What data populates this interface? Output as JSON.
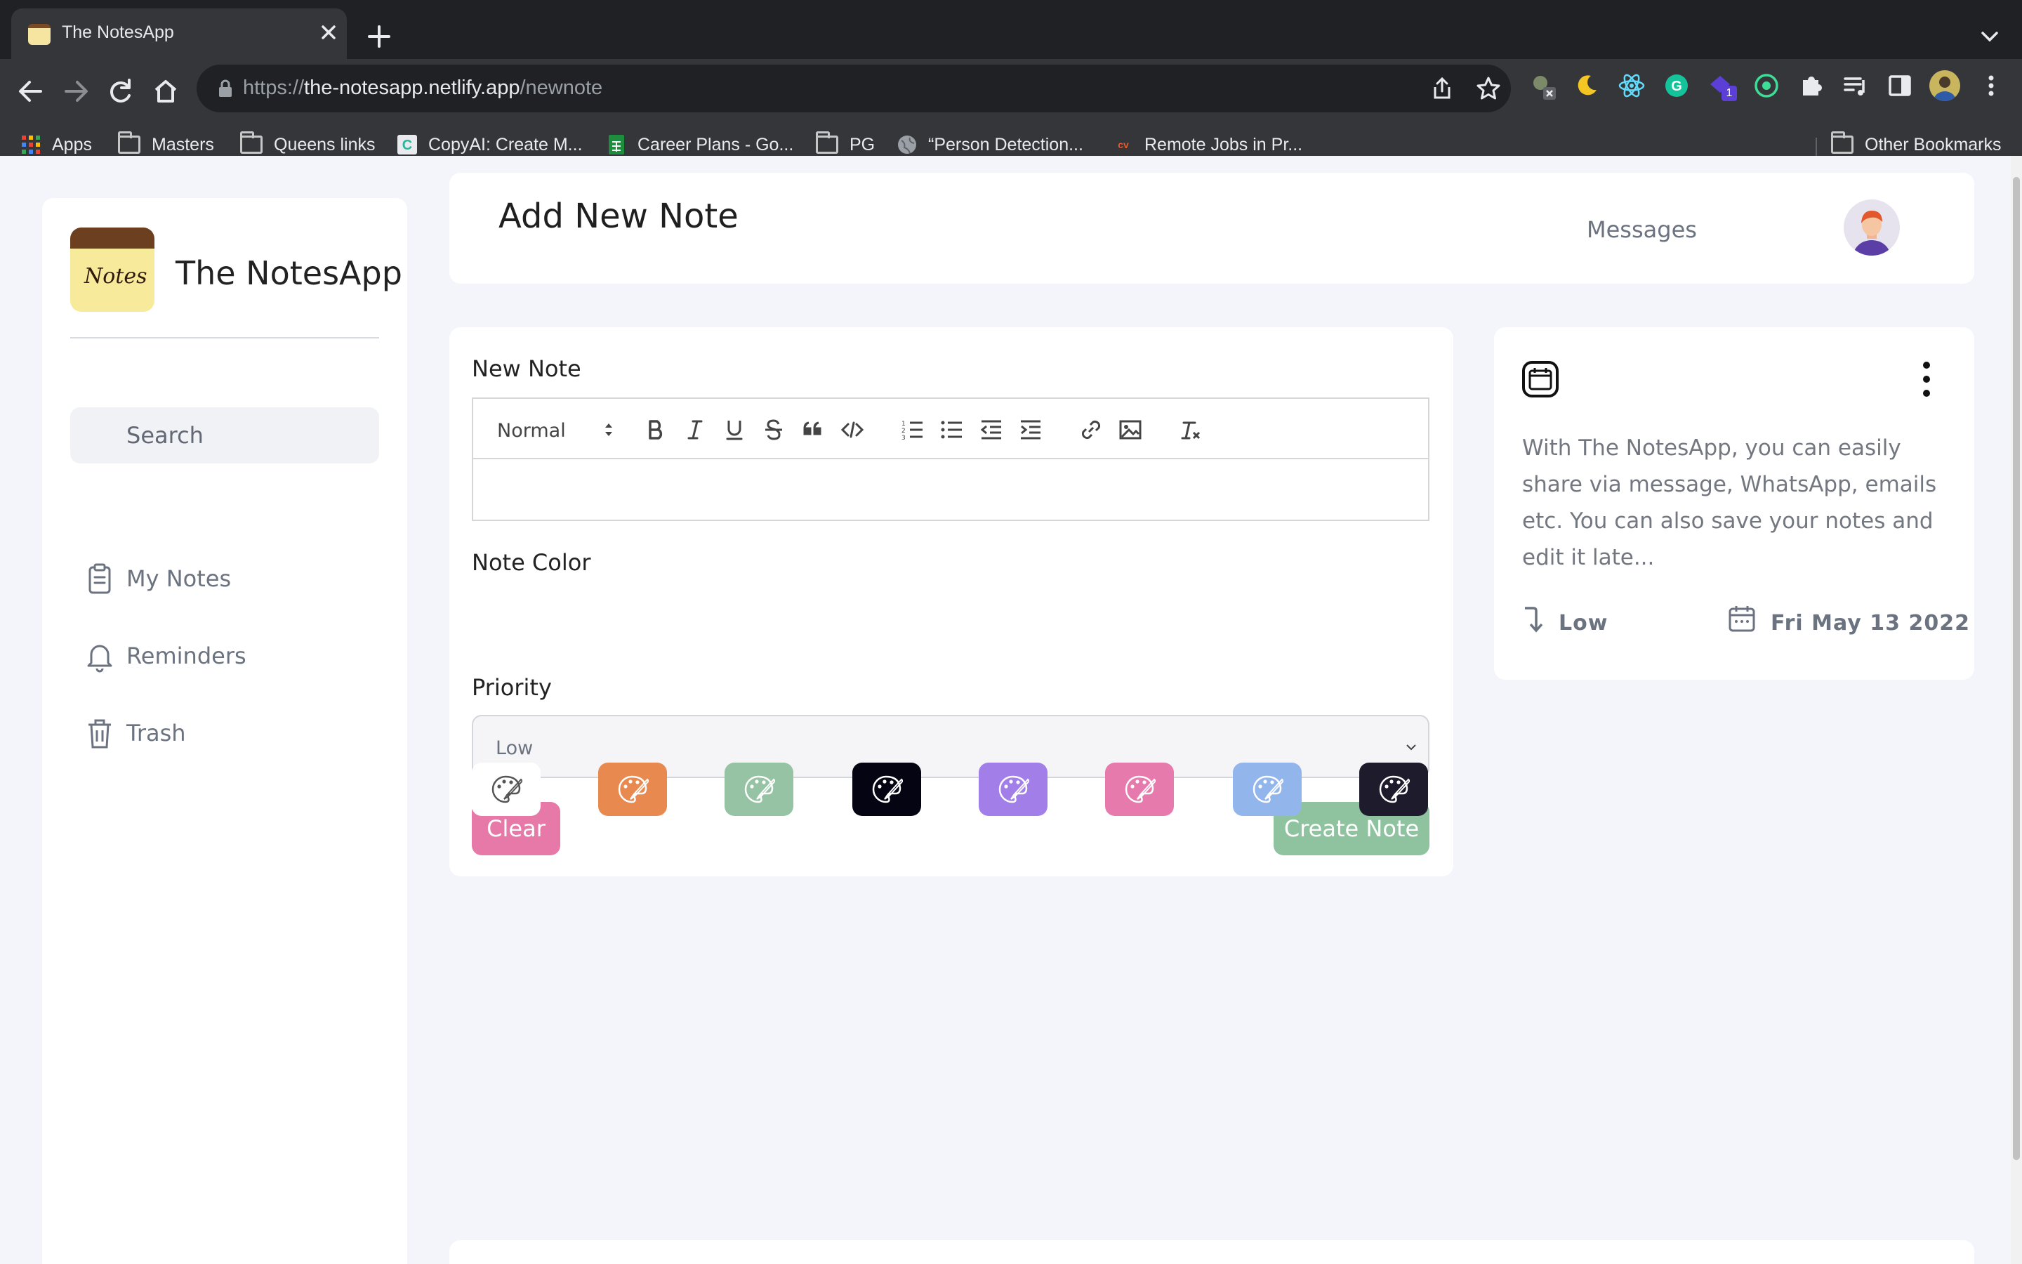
{
  "browser": {
    "tab_title": "The NotesApp",
    "url_scheme": "https://",
    "url_host": "the-notesapp.netlify.app",
    "url_path": "/newnote",
    "bookmarks": [
      {
        "label": "Apps",
        "icon": "apps-grid-icon"
      },
      {
        "label": "Masters",
        "icon": "folder-icon"
      },
      {
        "label": "Queens links",
        "icon": "folder-icon"
      },
      {
        "label": "CopyAI: Create M...",
        "icon": "copyai-icon"
      },
      {
        "label": "Career Plans - Go...",
        "icon": "sheets-icon"
      },
      {
        "label": "PG",
        "icon": "folder-icon"
      },
      {
        "label": "“Person Detection...",
        "icon": "globe-icon"
      },
      {
        "label": "Remote Jobs in Pr...",
        "icon": "cv-icon"
      }
    ],
    "other_bookmarks": "Other Bookmarks",
    "extension_badge": "1"
  },
  "sidebar": {
    "app_name": "The NotesApp",
    "logo_text": "Notes",
    "search_placeholder": "Search",
    "nav": [
      {
        "label": "My Notes",
        "icon": "clipboard-icon"
      },
      {
        "label": "Reminders",
        "icon": "bell-icon"
      },
      {
        "label": "Trash",
        "icon": "trash-icon"
      }
    ]
  },
  "header": {
    "title": "Add New Note",
    "messages": "Messages"
  },
  "form": {
    "new_note_label": "New Note",
    "editor_format": "Normal",
    "editor_value": "",
    "toolbar_tools": [
      "bold-icon",
      "italic-icon",
      "underline-icon",
      "strikethrough-icon",
      "blockquote-icon",
      "code-icon",
      "ordered-list-icon",
      "bullet-list-icon",
      "outdent-icon",
      "indent-icon",
      "link-icon",
      "image-icon",
      "clear-format-icon"
    ],
    "note_color_label": "Note Color",
    "colors": [
      "#ffffff",
      "#e8894f",
      "#96c3a3",
      "#040412",
      "#a17ee8",
      "#e67aac",
      "#92b5ec",
      "#1e1b2c"
    ],
    "priority_label": "Priority",
    "priority_value": "Low",
    "clear_label": "Clear",
    "create_label": "Create Note"
  },
  "preview": {
    "text": "With The NotesApp, you can easily share via message, WhatsApp, emails etc. You can also save your notes and edit it late...",
    "priority": "Low",
    "date": "Fri May 13 2022"
  },
  "colors": {
    "page_bg": "#f4f5fa",
    "clear_button": "#e779a9",
    "create_button": "#8fc3a0"
  }
}
